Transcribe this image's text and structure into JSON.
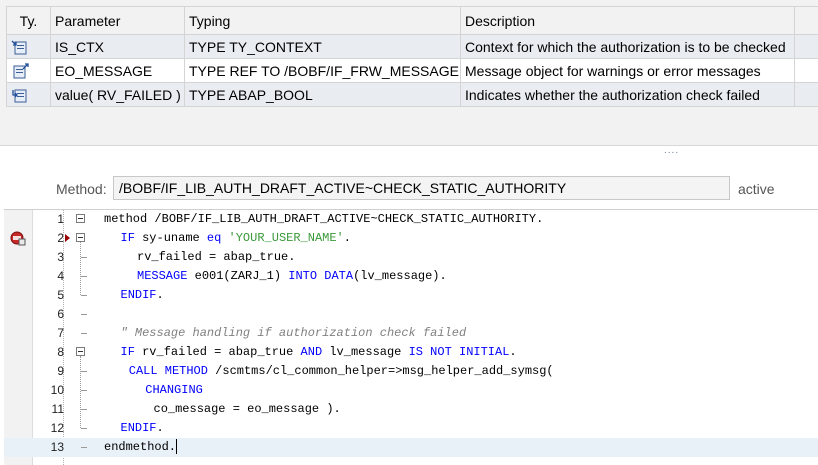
{
  "params_table": {
    "columns": [
      "Ty.",
      "Parameter",
      "Typing",
      "Description"
    ],
    "rows": [
      {
        "type_icon": "importing-icon",
        "parameter": "IS_CTX",
        "typing": "TYPE TY_CONTEXT",
        "description": "Context for which the authorization is to be checked"
      },
      {
        "type_icon": "exporting-icon",
        "parameter": "EO_MESSAGE",
        "typing": "TYPE REF TO /BOBF/IF_FRW_MESSAGE",
        "description": "Message object for warnings or error messages"
      },
      {
        "type_icon": "returning-icon",
        "parameter": "value( RV_FAILED )",
        "typing": "TYPE ABAP_BOOL",
        "description": "Indicates whether the authorization check failed"
      }
    ]
  },
  "splitter_grip": "....",
  "method": {
    "label": "Method:",
    "name": "/BOBF/IF_LIB_AUTH_DRAFT_ACTIVE~CHECK_STATIC_AUTHORITY",
    "status": "active"
  },
  "editor": {
    "breakpoint_icon": "breakpoint-icon",
    "current_line": 13,
    "lines": [
      {
        "no": "1",
        "indent": 0,
        "tokens": [
          [
            "kw0",
            "method"
          ],
          [
            "kw0",
            " /BOBF/IF_LIB_AUTH_DRAFT_ACTIVE~CHECK_STATIC_AUTHORITY."
          ]
        ]
      },
      {
        "no": "2",
        "indent": 1,
        "tokens": [
          [
            "kw",
            "IF"
          ],
          [
            "kw0",
            " sy-uname "
          ],
          [
            "kw",
            "eq"
          ],
          [
            "kw0",
            " "
          ],
          [
            "str",
            "'YOUR_USER_NAME'"
          ],
          [
            "kw0",
            "."
          ]
        ]
      },
      {
        "no": "3",
        "indent": 2,
        "tokens": [
          [
            "kw0",
            "rv_failed = abap_true."
          ]
        ]
      },
      {
        "no": "4",
        "indent": 2,
        "tokens": [
          [
            "kw",
            "MESSAGE"
          ],
          [
            "kw0",
            " e001(ZARJ_1) "
          ],
          [
            "kw",
            "INTO"
          ],
          [
            "kw0",
            " "
          ],
          [
            "kw",
            "DATA"
          ],
          [
            "kw0",
            "(lv_message)."
          ]
        ]
      },
      {
        "no": "5",
        "indent": 1,
        "tokens": [
          [
            "kw",
            "ENDIF"
          ],
          [
            "kw0",
            "."
          ]
        ]
      },
      {
        "no": "6",
        "indent": 0,
        "tokens": []
      },
      {
        "no": "7",
        "indent": 1,
        "tokens": [
          [
            "cmt",
            "\" Message handling if authorization check failed"
          ]
        ]
      },
      {
        "no": "8",
        "indent": 1,
        "tokens": [
          [
            "kw",
            "IF"
          ],
          [
            "kw0",
            " rv_failed = abap_true "
          ],
          [
            "kw",
            "AND"
          ],
          [
            "kw0",
            " lv_message "
          ],
          [
            "kw",
            "IS NOT INITIAL"
          ],
          [
            "kw0",
            "."
          ]
        ]
      },
      {
        "no": "9",
        "indent": 1.5,
        "tokens": [
          [
            "kw",
            "CALL METHOD"
          ],
          [
            "kw0",
            " /scmtms/cl_common_helper=>msg_helper_add_symsg("
          ]
        ]
      },
      {
        "no": "10",
        "indent": 2.5,
        "tokens": [
          [
            "kw",
            "CHANGING"
          ]
        ]
      },
      {
        "no": "11",
        "indent": 3,
        "tokens": [
          [
            "kw0",
            "co_message = eo_message )."
          ]
        ]
      },
      {
        "no": "12",
        "indent": 1,
        "tokens": [
          [
            "kw",
            "ENDIF"
          ],
          [
            "kw0",
            "."
          ]
        ]
      },
      {
        "no": "13",
        "indent": 0,
        "tokens": [
          [
            "kw0",
            "endmethod."
          ]
        ]
      }
    ]
  }
}
